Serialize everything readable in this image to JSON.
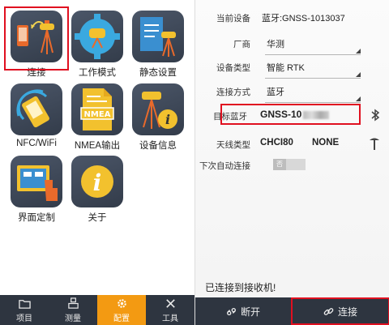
{
  "left_menu": {
    "tiles": [
      {
        "label": "连接",
        "icon": "connect-device-icon"
      },
      {
        "label": "工作模式",
        "icon": "work-mode-gear-icon"
      },
      {
        "label": "静态设置",
        "icon": "static-settings-icon"
      },
      {
        "label": "NFC/WiFi",
        "icon": "nfc-wifi-icon"
      },
      {
        "label": "NMEA输出",
        "icon": "nmea-output-icon"
      },
      {
        "label": "设备信息",
        "icon": "device-info-icon"
      },
      {
        "label": "界面定制",
        "icon": "ui-customize-icon"
      },
      {
        "label": "关于",
        "icon": "about-info-icon"
      }
    ]
  },
  "tabbar": {
    "tabs": [
      {
        "label": "项目",
        "icon": "folder-icon"
      },
      {
        "label": "测量",
        "icon": "survey-icon"
      },
      {
        "label": "配置",
        "icon": "gear-icon",
        "active": true
      },
      {
        "label": "工具",
        "icon": "tools-icon"
      }
    ]
  },
  "device": {
    "current_device_label": "当前设备",
    "current_device_value": "蓝牙:GNSS-1013037",
    "manufacturer_label": "厂商",
    "manufacturer_value": "华测",
    "device_type_label": "设备类型",
    "device_type_value": "智能 RTK",
    "connection_label": "连接方式",
    "connection_value": "蓝牙",
    "target_bt_label": "目标蓝牙",
    "target_bt_value": "GNSS-10",
    "antenna_label": "天线类型",
    "antenna_model": "CHCI80",
    "antenna_mode": "NONE",
    "auto_connect_label": "下次自动连接",
    "auto_connect_state": "否"
  },
  "status_text": "已连接到接收机!",
  "buttons": {
    "disconnect": "断开",
    "connect": "连接"
  },
  "colors": {
    "accent": "#f39a12",
    "highlight": "#e01020",
    "bar": "#2e3540"
  }
}
